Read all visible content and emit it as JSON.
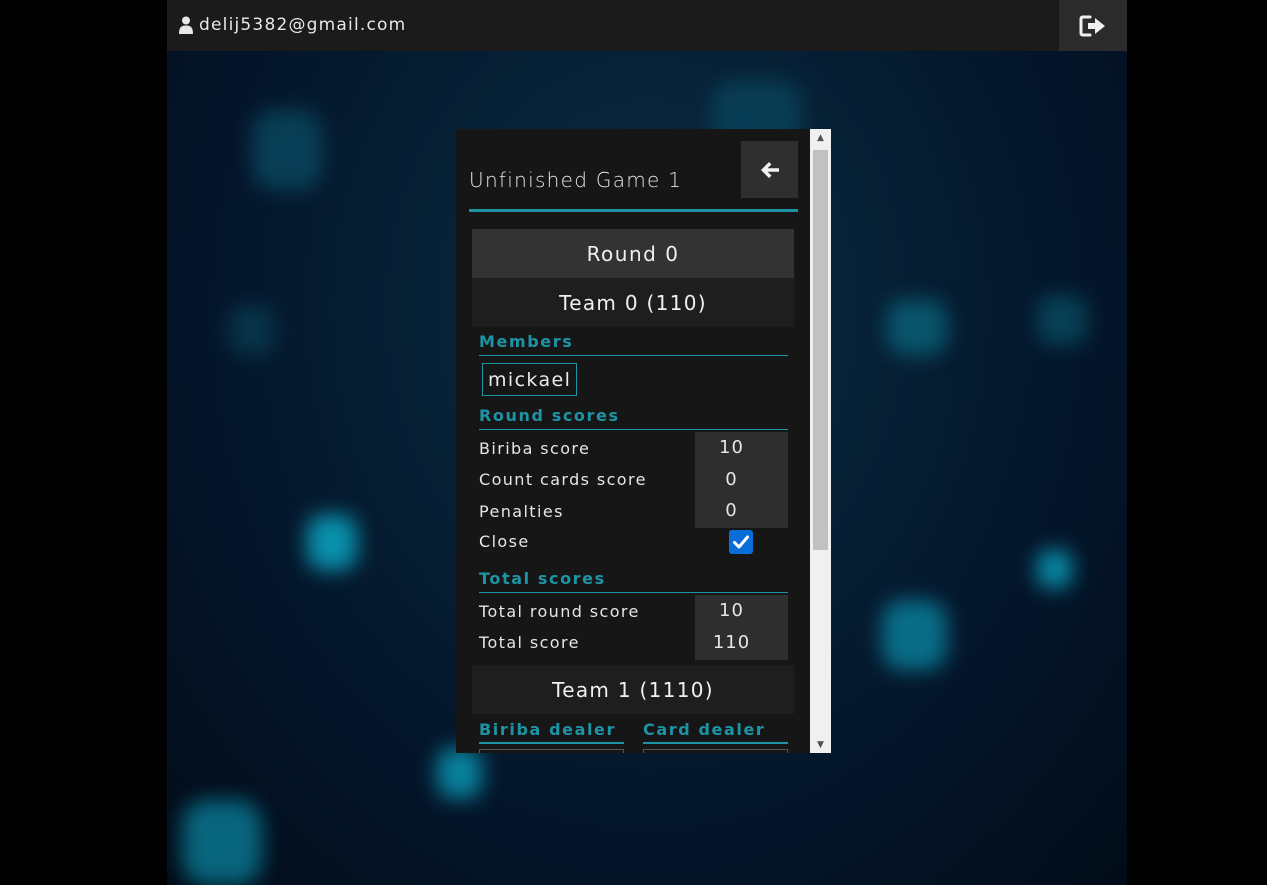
{
  "user": {
    "email": "delij5382@gmail.com",
    "icon": "user-icon"
  },
  "logout": {
    "icon": "sign-out-icon"
  },
  "game": {
    "title": "Unfinished Game 1",
    "back_icon": "arrow-left-icon",
    "round_label": "Round 0",
    "teams": [
      {
        "header": "Team 0 (110)",
        "members_title": "Members",
        "members": [
          "mickael"
        ],
        "round_scores_title": "Round scores",
        "round_scores": [
          {
            "label": "Biriba score",
            "value": "10"
          },
          {
            "label": "Count cards score",
            "value": "0"
          },
          {
            "label": "Penalties",
            "value": "0"
          }
        ],
        "close_label": "Close",
        "close_checked": true,
        "total_scores_title": "Total scores",
        "total_scores": [
          {
            "label": "Total round score",
            "value": "10"
          },
          {
            "label": "Total score",
            "value": "110"
          }
        ]
      },
      {
        "header": "Team 1 (1110)",
        "biriba_dealer_title": "Biriba dealer",
        "card_dealer_title": "Card dealer"
      }
    ]
  },
  "colors": {
    "accent": "#1d94a6",
    "panel_bg": "#161616",
    "topbar_bg": "#1b1b1b",
    "checkbox": "#0b6ed8"
  }
}
